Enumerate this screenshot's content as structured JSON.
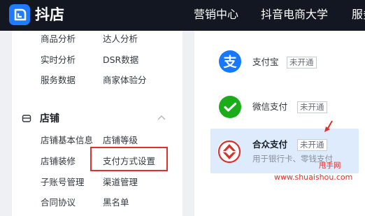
{
  "header": {
    "logo_text": "抖店",
    "nav": [
      "营销中心",
      "抖音电商大学",
      "服务"
    ]
  },
  "sidebar": {
    "top_rows": [
      [
        "商品分析",
        "达人分析"
      ],
      [
        "实时分析",
        "DSR数据"
      ],
      [
        "服务数据",
        "商家体验分"
      ]
    ],
    "section": {
      "title": "店铺",
      "rows": [
        [
          "店铺基本信息",
          "店铺等级"
        ],
        [
          "店铺装修",
          "支付方式设置"
        ],
        [
          "子账号管理",
          "渠道管理"
        ],
        [
          "合同协议",
          "黑名单"
        ]
      ]
    }
  },
  "payments": [
    {
      "name": "支付宝",
      "status": "未开通",
      "icon": "alipay-icon"
    },
    {
      "name": "微信支付",
      "status": "未开通",
      "icon": "wechat-pay-icon"
    },
    {
      "name": "合众支付",
      "status": "未开通",
      "icon": "hezhong-pay-icon",
      "description": "用于银行卡、零钱支付"
    }
  ],
  "watermark": {
    "line1": "甩手网",
    "line2": "www.shuaishou.com"
  },
  "colors": {
    "topbar": "#131722",
    "brand_blue": "#1f7afc",
    "alipay": "#1677ff",
    "wechat": "#1aad19",
    "annotation_red": "#e0302c",
    "selected_bg": "#ddebfc"
  }
}
